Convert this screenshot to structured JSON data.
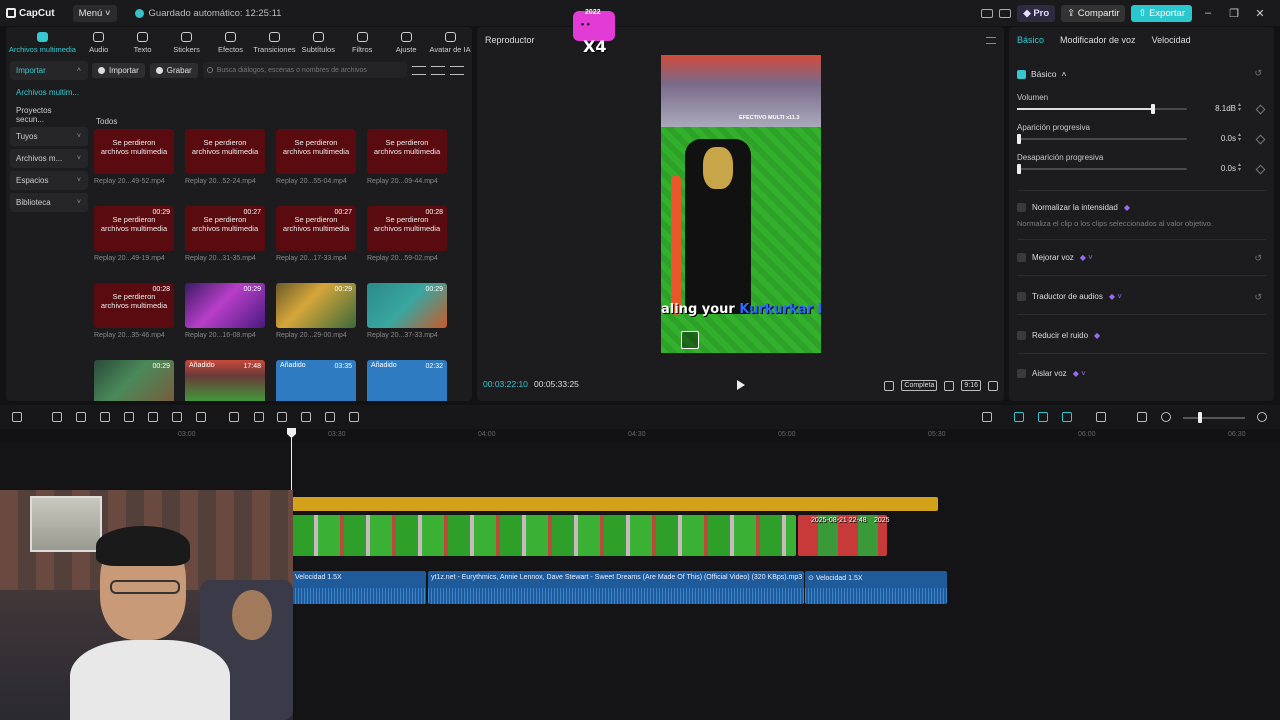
{
  "app": {
    "logo": "CapCut",
    "menu": "Menú",
    "autosave": "Guardado automático: 12:25:11",
    "pro": "Pro",
    "share": "Compartir",
    "export": "Exportar"
  },
  "badge": {
    "number": "2022",
    "multiplier": "X4"
  },
  "media": {
    "tools": [
      {
        "label": "Archivos multimedia",
        "icon": "media-icon"
      },
      {
        "label": "Audio",
        "icon": "audio-icon"
      },
      {
        "label": "Texto",
        "icon": "text-icon"
      },
      {
        "label": "Stickers",
        "icon": "sticker-icon"
      },
      {
        "label": "Efectos",
        "icon": "effects-icon"
      },
      {
        "label": "Transiciones",
        "icon": "transitions-icon"
      },
      {
        "label": "Subtítulos",
        "icon": "subtitles-icon"
      },
      {
        "label": "Filtros",
        "icon": "filters-icon"
      },
      {
        "label": "Ajuste",
        "icon": "adjust-icon"
      },
      {
        "label": "Avatar de IA",
        "icon": "avatar-icon"
      }
    ],
    "sidebar": [
      {
        "label": "Importar",
        "chev": "˄"
      },
      {
        "label": "Archivos multim...",
        "chev": ""
      },
      {
        "label": "Proyectos secun...",
        "chev": ""
      },
      {
        "label": "Tuyos",
        "chev": "˅"
      },
      {
        "label": "Archivos m...",
        "chev": "˅"
      },
      {
        "label": "Espacios",
        "chev": "˅"
      },
      {
        "label": "Biblioteca",
        "chev": "˅"
      }
    ],
    "import_btn": "Importar",
    "record_btn": "Grabar",
    "search_placeholder": "Busca diálogos, escenas o nombres de archivos",
    "section": "Todos",
    "missing_text": "Se perdieron archivos multimedia",
    "added_text": "Añadido",
    "items": [
      {
        "caption": "Replay 20...49-52.mp4",
        "duration": "",
        "kind": "missing"
      },
      {
        "caption": "Replay 20...52-24.mp4",
        "duration": "",
        "kind": "missing"
      },
      {
        "caption": "Replay 20...55-04.mp4",
        "duration": "",
        "kind": "missing"
      },
      {
        "caption": "Replay 20...09-44.mp4",
        "duration": "",
        "kind": "missing"
      },
      {
        "caption": "Replay 20...49-19.mp4",
        "duration": "00:29",
        "kind": "missing"
      },
      {
        "caption": "Replay 20...31-35.mp4",
        "duration": "00:27",
        "kind": "missing"
      },
      {
        "caption": "Replay 20...17-33.mp4",
        "duration": "00:27",
        "kind": "missing"
      },
      {
        "caption": "Replay 20...59-02.mp4",
        "duration": "00:28",
        "kind": "missing"
      },
      {
        "caption": "Replay 20...35-46.mp4",
        "duration": "00:28",
        "kind": "missing"
      },
      {
        "caption": "Replay 20...16-08.mp4",
        "duration": "00:29",
        "kind": "img1"
      },
      {
        "caption": "Replay 20...29-00.mp4",
        "duration": "00:29",
        "kind": "img2"
      },
      {
        "caption": "Replay 20...37-33.mp4",
        "duration": "00:29",
        "kind": "img3"
      },
      {
        "caption": "Replay 20...33-44.mp4",
        "duration": "00:29",
        "kind": "img4"
      },
      {
        "caption": "2025-08-...8-48.mp4",
        "duration": "17:48",
        "kind": "img5",
        "added": true
      },
      {
        "caption": "yt1z.net -... KBps).mp3",
        "duration": "03:35",
        "kind": "audio",
        "added": true
      },
      {
        "caption": "yt1z.net -... KBps).mp3",
        "duration": "02:32",
        "kind": "audio",
        "added": true
      }
    ]
  },
  "player": {
    "title": "Reproductor",
    "current_time": "00:03:22:10",
    "total_time": "00:05:33:25",
    "quality": "Completa",
    "ratio": "9:16",
    "subtitle_a": "aling your ",
    "subtitle_b": "Kurkurkar Kurk",
    "sign": "EFECTIVO MULTI x11.3"
  },
  "inspector": {
    "tabs": [
      "Básico",
      "Modificador de voz",
      "Velocidad"
    ],
    "section": "Básico",
    "volume_label": "Volumen",
    "volume_value": "8.1dB",
    "volume_level": 0.8,
    "fade_in_label": "Aparición progresiva",
    "fade_in_value": "0.0s",
    "fade_out_label": "Desaparición progresiva",
    "fade_out_value": "0.0s",
    "normalize_label": "Normalizar la intensidad",
    "normalize_desc": "Normaliza el clip o los clips seleccionados al valor objetivo.",
    "enhance_label": "Mejorar voz",
    "translate_label": "Traductor de audios",
    "noise_label": "Reducir el ruido",
    "isolate_label": "Aislar voz"
  },
  "timeline": {
    "ticks": [
      "03:00",
      "03:30",
      "04:00",
      "04:30",
      "05:00",
      "05:30",
      "06:00",
      "06:30"
    ],
    "video_clip2_label": "2025-08-21 22-48",
    "video_clip3_label": "2025",
    "video_clip1_label": "20",
    "audio1_label": "Velocidad 1.5X",
    "audio2_label": "yt1z.net - Eurythmics, Annie Lennox, Dave Stewart - Sweet Dreams (Are Made Of This) (Official Video) (320 KBps).mp3",
    "audio3_label": "Velocidad 1.5X"
  },
  "colors": {
    "accent": "#37c8cf",
    "gold": "#d4a21a",
    "audio": "#1f5a9a",
    "missing": "#5a0b10"
  }
}
